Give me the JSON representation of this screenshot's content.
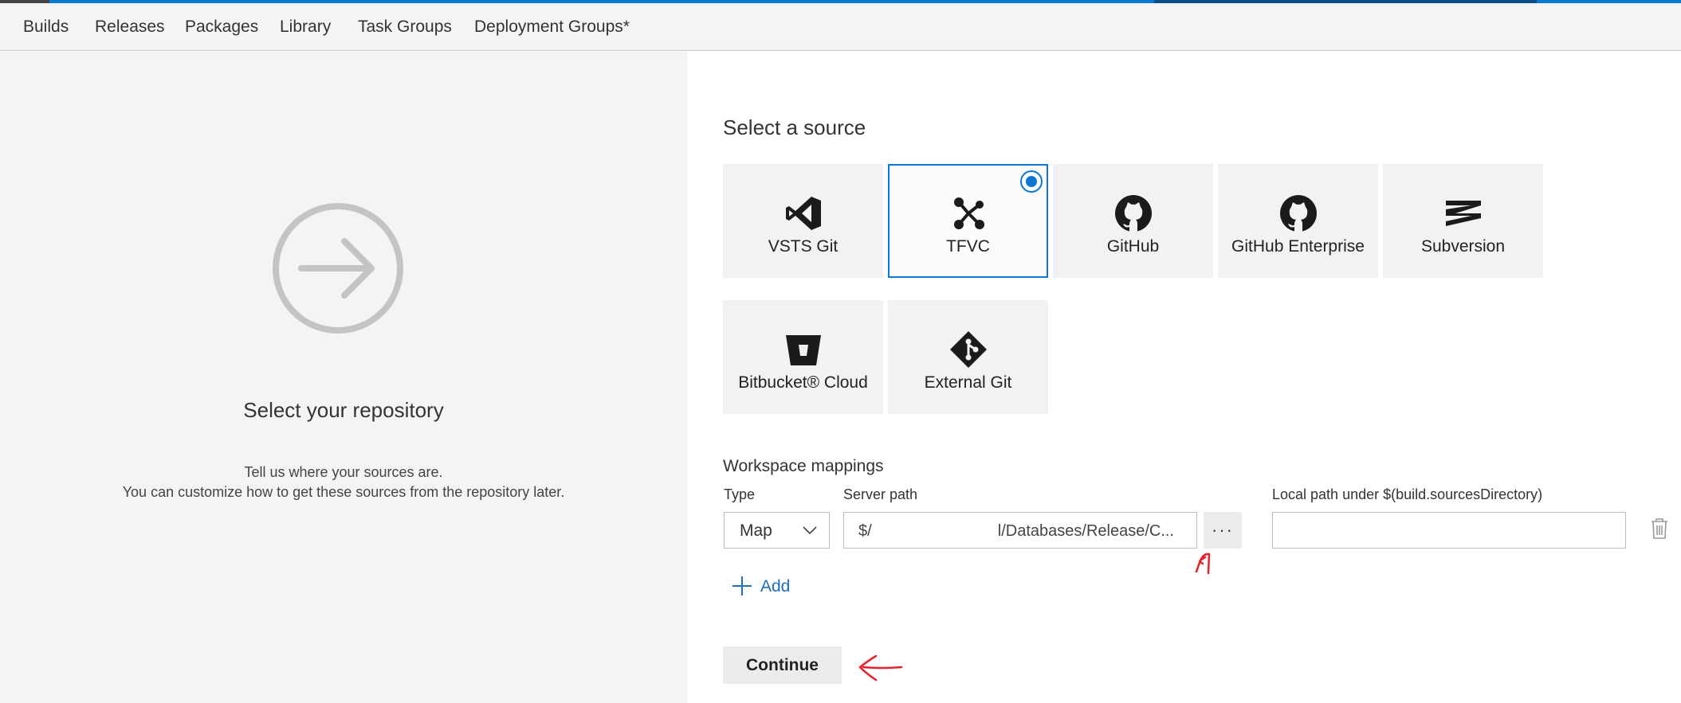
{
  "nav": {
    "items": [
      "Builds",
      "Releases",
      "Packages",
      "Library",
      "Task Groups",
      "Deployment Groups*"
    ]
  },
  "left": {
    "title": "Select your repository",
    "desc_line1": "Tell us where your sources are.",
    "desc_line2": "You can customize how to get these sources from the repository later.",
    "icon": "arrow-circle-icon"
  },
  "source": {
    "title": "Select a source",
    "selected": "TFVC",
    "tiles": [
      {
        "label": "VSTS Git",
        "icon": "visual-studio-icon"
      },
      {
        "label": "TFVC",
        "icon": "tfvc-icon"
      },
      {
        "label": "GitHub",
        "icon": "github-icon"
      },
      {
        "label": "GitHub Enterprise",
        "icon": "github-icon"
      },
      {
        "label": "Subversion",
        "icon": "subversion-icon"
      },
      {
        "label": "Bitbucket® Cloud",
        "icon": "bitbucket-icon"
      },
      {
        "label": "External Git",
        "icon": "git-icon"
      }
    ]
  },
  "workspace": {
    "title": "Workspace mappings",
    "type_label": "Type",
    "server_label": "Server path",
    "local_label": "Local path under $(build.sourcesDirectory)",
    "type_value": "Map",
    "server_prefix": "$/",
    "server_suffix": "l/Databases/Release/C...",
    "ellipsis": "···",
    "local_value": "",
    "add_label": "Add"
  },
  "continue_label": "Continue",
  "colors": {
    "accent": "#0a78d4",
    "annotation": "#e8202a",
    "panel": "#f4f4f4",
    "link": "#1e6fbf"
  }
}
